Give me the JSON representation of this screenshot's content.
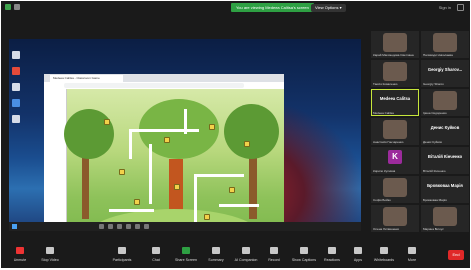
{
  "top": {
    "share_banner": "You are viewing Medeea Calitsa's screen",
    "view_options": "View Options ▾",
    "sign_in": "Sign in"
  },
  "browser": {
    "tab_title": "Medeea Calitsa - Classroom Game"
  },
  "gallery": [
    {
      "type": "video",
      "caption": "Карай Магомедова Светлана",
      "active": false
    },
    {
      "type": "video",
      "caption": "Паливоди Николаева",
      "active": false
    },
    {
      "type": "video",
      "caption": "Таисія Коваленко",
      "active": false
    },
    {
      "type": "name",
      "name": "Georgiy Sharov...",
      "caption": "Georgiy Sharov",
      "active": false
    },
    {
      "type": "name",
      "name": "Medeea Calitsa",
      "caption": "Medeea Calitsa",
      "active": true
    },
    {
      "type": "video",
      "caption": "Ірина Сидоренко",
      "active": false
    },
    {
      "type": "video",
      "caption": "Анастасія Гончаренко",
      "active": false
    },
    {
      "type": "name",
      "name": "Денис Куйков",
      "caption": "Денис Куйков",
      "active": false
    },
    {
      "type": "letter",
      "letter": "K",
      "caption": "Кирило Куликов",
      "active": false
    },
    {
      "type": "name",
      "name": "Віталій Кінченко",
      "caption": "Віталій Кінченко",
      "active": false
    },
    {
      "type": "video",
      "caption": "Софія Бойко",
      "active": false
    },
    {
      "type": "name",
      "name": "Бровковаа Марія",
      "caption": "Бровковаа Марія",
      "active": false
    },
    {
      "type": "video",
      "caption": "Олена Литвиненко",
      "active": false
    },
    {
      "type": "video",
      "caption": "Марина Білоус",
      "active": false
    }
  ],
  "toolbar": [
    {
      "label": "Unmute",
      "state": "red"
    },
    {
      "label": "Stop Video",
      "state": ""
    },
    {
      "label": "Participants",
      "state": ""
    },
    {
      "label": "Chat",
      "state": ""
    },
    {
      "label": "Share Screen",
      "state": "green"
    },
    {
      "label": "Summary",
      "state": ""
    },
    {
      "label": "AI Companion",
      "state": ""
    },
    {
      "label": "Record",
      "state": ""
    },
    {
      "label": "Show Captions",
      "state": ""
    },
    {
      "label": "Reactions",
      "state": ""
    },
    {
      "label": "Apps",
      "state": ""
    },
    {
      "label": "Whiteboards",
      "state": ""
    },
    {
      "label": "More",
      "state": ""
    }
  ],
  "end_label": "End"
}
